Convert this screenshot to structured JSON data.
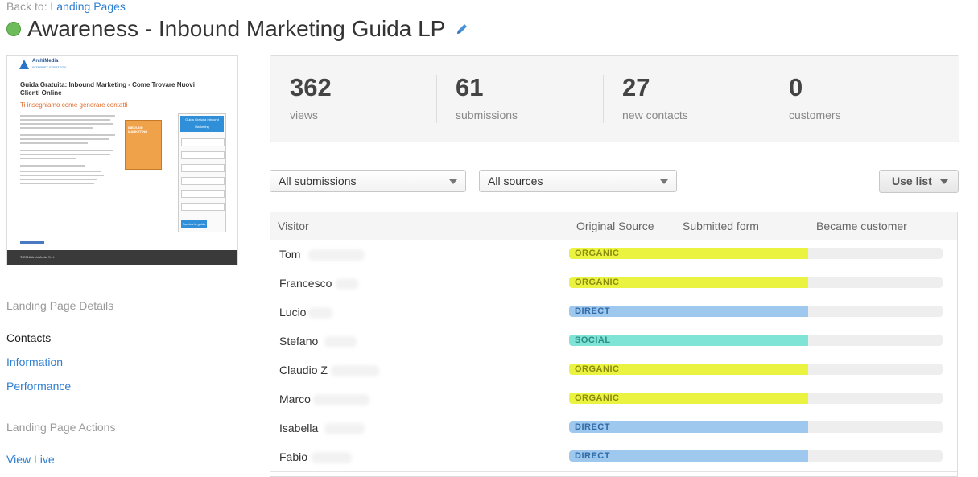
{
  "header": {
    "back_prefix": "Back to:",
    "back_link": "Landing Pages",
    "title": "Awareness - Inbound Marketing Guida LP",
    "status_color": "#6dbb5a"
  },
  "thumbnail": {
    "brand": "ArchiMedia",
    "brand_sub": "INTERNET STRATEGY",
    "headline": "Guida Gratuita: Inbound Marketing - Come Trovare Nuovi Clienti Online",
    "subheadline": "Ti insegniamo come generare contatti",
    "book_title": "INBOUND MARKETING",
    "form_title": "Guida Gratuita Inbound Marketing",
    "form_button": "Scarica la guida",
    "footer": "© 2016 ArchiMedia S.r.l."
  },
  "sidebar": {
    "details_heading": "Landing Page Details",
    "items": [
      "Contacts",
      "Information",
      "Performance"
    ],
    "actions_heading": "Landing Page Actions",
    "actions": [
      "View Live"
    ]
  },
  "stats": [
    {
      "value": "362",
      "label": "views"
    },
    {
      "value": "61",
      "label": "submissions"
    },
    {
      "value": "27",
      "label": "new contacts"
    },
    {
      "value": "0",
      "label": "customers"
    }
  ],
  "filters": {
    "submissions": "All submissions",
    "sources": "All sources",
    "use_list": "Use list"
  },
  "table": {
    "columns": [
      "Visitor",
      "Original Source",
      "Submitted form",
      "Became customer"
    ],
    "rows": [
      {
        "visitor": "Tom",
        "source": "ORGANIC",
        "source_color": "#eaf33f"
      },
      {
        "visitor": "Francesco",
        "source": "ORGANIC",
        "source_color": "#eaf33f"
      },
      {
        "visitor": "Lucio",
        "source": "DIRECT",
        "source_color": "#9ec8ee"
      },
      {
        "visitor": "Stefano",
        "source": "SOCIAL",
        "source_color": "#7fe3d6"
      },
      {
        "visitor": "Claudio Z",
        "source": "ORGANIC",
        "source_color": "#eaf33f"
      },
      {
        "visitor": "Marco",
        "source": "ORGANIC",
        "source_color": "#eaf33f"
      },
      {
        "visitor": "Isabella",
        "source": "DIRECT",
        "source_color": "#9ec8ee"
      },
      {
        "visitor": "Fabio",
        "source": "DIRECT",
        "source_color": "#9ec8ee"
      }
    ]
  }
}
